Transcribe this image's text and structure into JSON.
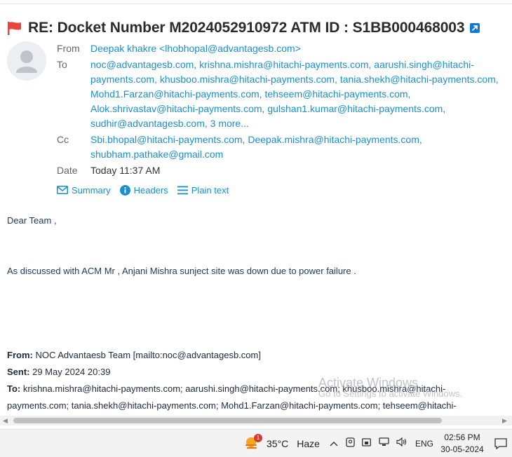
{
  "email": {
    "subject": "RE: Docket Number M2024052910972 ATM ID : S1BB000468003",
    "labels": {
      "from": "From",
      "to": "To",
      "cc": "Cc",
      "date": "Date"
    },
    "from": "Deepak khakre <lhobhopal@advantagesb.com>",
    "to": [
      "noc@advantagesb.com, ",
      "krishna.mishra@hitachi-payments.com, ",
      "aarushi.singh@hitachi-payments.com, ",
      "khusboo.mishra@hitachi-payments.com, ",
      "tania.shekh@hitachi-payments.com,",
      "Mohd1.Farzan@hitachi-payments.com, ",
      "tehseem@hitachi-payments.com,",
      "Alok.shrivastav@hitachi-payments.com, ",
      "gulshan1.kumar@hitachi-payments.com,",
      "sudhir@advantagesb.com, "
    ],
    "to_more": "3 more...",
    "cc": [
      "Sbi.bhopal@hitachi-payments.com, ",
      "Deepak.mishra@hitachi-payments.com,",
      "shubham.pathake@gmail.com"
    ],
    "date": "Today 11:37 AM",
    "actions": {
      "summary": "Summary",
      "headers": "Headers",
      "plain_text": "Plain text"
    },
    "body": {
      "greeting": "Dear Team ,",
      "message": "As discussed with ACM Mr , Anjani Mishra sunject site was down due to power failure ."
    },
    "quoted": {
      "from_label": "From:",
      "from_value": " NOC Advantaesb Team [mailto:noc@advantagesb.com]",
      "sent_label": "Sent:",
      "sent_value": " 29 May 2024 20:39",
      "to_label": "To:",
      "to_value": " krishna.mishra@hitachi-payments.com; aarushi.singh@hitachi-payments.com; khusboo.mishra@hitachi-payments.com; tania.shekh@hitachi-payments.com; Mohd1.Farzan@hitachi-payments.com; tehseem@hitachi-"
    }
  },
  "watermark": {
    "line1": "Activate Windows",
    "line2": "Go to Settings to activate Windows."
  },
  "taskbar": {
    "weather_badge": "1",
    "temperature": "35°C",
    "condition": "Haze",
    "language": "ENG",
    "time": "02:56 PM",
    "date": "30-05-2024"
  },
  "colors": {
    "link": "#1a8fd0",
    "flag": "#e8453c",
    "accent": "#0f7ad8"
  }
}
